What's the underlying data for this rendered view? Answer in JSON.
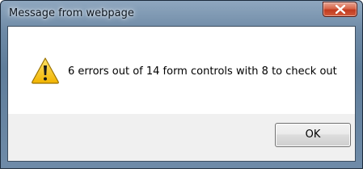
{
  "window": {
    "title": "Message from webpage"
  },
  "dialog": {
    "message": "6 errors out of 14 form controls with 8 to check out",
    "icon": "warning-icon",
    "ok_label": "OK"
  },
  "colors": {
    "close_button": "#c13a1e",
    "warning_yellow": "#f5c400",
    "content_bg": "#ffffff",
    "footer_bg": "#f0f0f0"
  }
}
